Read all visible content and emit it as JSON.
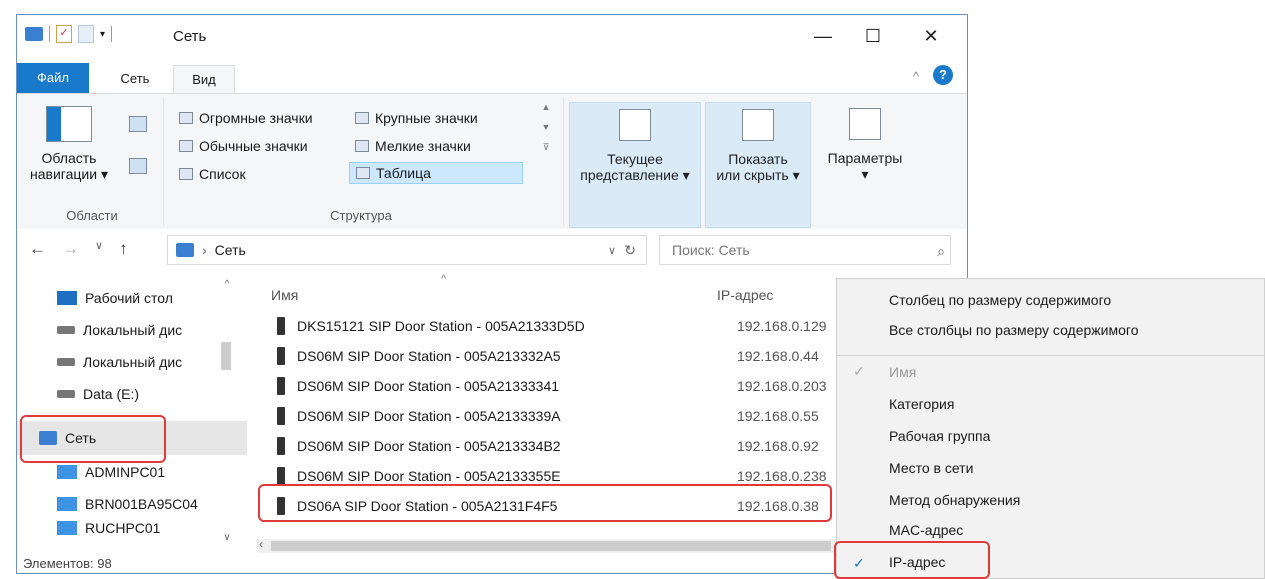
{
  "window": {
    "title": "Сеть",
    "min": "—",
    "max": "☐",
    "close": "✕"
  },
  "tabs": {
    "file": "Файл",
    "network": "Сеть",
    "view": "Вид",
    "collapse": "^",
    "help": "?"
  },
  "ribbon": {
    "nav_pane_label": "Область навигации ▾",
    "nav_pane_line1": "Область",
    "nav_pane_line2": "навигации ▾",
    "group_areas": "Области",
    "layout": {
      "huge_icons": "Огромные значки",
      "large_icons": "Крупные значки",
      "normal_icons": "Обычные значки",
      "small_icons": "Мелкие значки",
      "list": "Список",
      "table": "Таблица"
    },
    "group_structure": "Структура",
    "current_view_1": "Текущее",
    "current_view_2": "представление ▾",
    "show_hide_1": "Показать",
    "show_hide_2": "или скрыть ▾",
    "options_1": "Параметры",
    "options_2": "▾"
  },
  "address": {
    "path": "Сеть",
    "search_placeholder": "Поиск: Сеть"
  },
  "nav": {
    "items": [
      "Рабочий стол",
      "Локальный дис",
      "Локальный дис",
      "Data (E:)",
      "Сеть",
      "ADMINPC01",
      "BRN001BA95C04",
      "RUCHPC01"
    ]
  },
  "columns": {
    "name": "Имя",
    "ip": "IP-адрес"
  },
  "rows": [
    {
      "name": "DKS15121 SIP Door Station - 005A21333D5D",
      "ip": "192.168.0.129"
    },
    {
      "name": "DS06M SIP Door Station - 005A213332A5",
      "ip": "192.168.0.44"
    },
    {
      "name": "DS06M SIP Door Station - 005A21333341",
      "ip": "192.168.0.203"
    },
    {
      "name": "DS06M SIP Door Station - 005A2133339A",
      "ip": "192.168.0.55"
    },
    {
      "name": "DS06M SIP Door Station - 005A213334B2",
      "ip": "192.168.0.92"
    },
    {
      "name": "DS06M SIP Door Station - 005A2133355E",
      "ip": "192.168.0.238"
    },
    {
      "name": "DS06A  SIP Door Station - 005A2131F4F5",
      "ip": "192.168.0.38"
    }
  ],
  "status": {
    "items": "Элементов: 98"
  },
  "context_menu": {
    "fit_column": "Столбец по размеру содержимого",
    "fit_all": "Все столбцы по размеру содержимого",
    "name": "Имя",
    "category": "Категория",
    "workgroup": "Рабочая группа",
    "network_location": "Место в сети",
    "discovery": "Метод обнаружения",
    "mac": "MAC-адрес",
    "ip": "IP-адрес"
  },
  "colors": {
    "accent": "#1979ca",
    "highlight": "#e03a3a"
  }
}
